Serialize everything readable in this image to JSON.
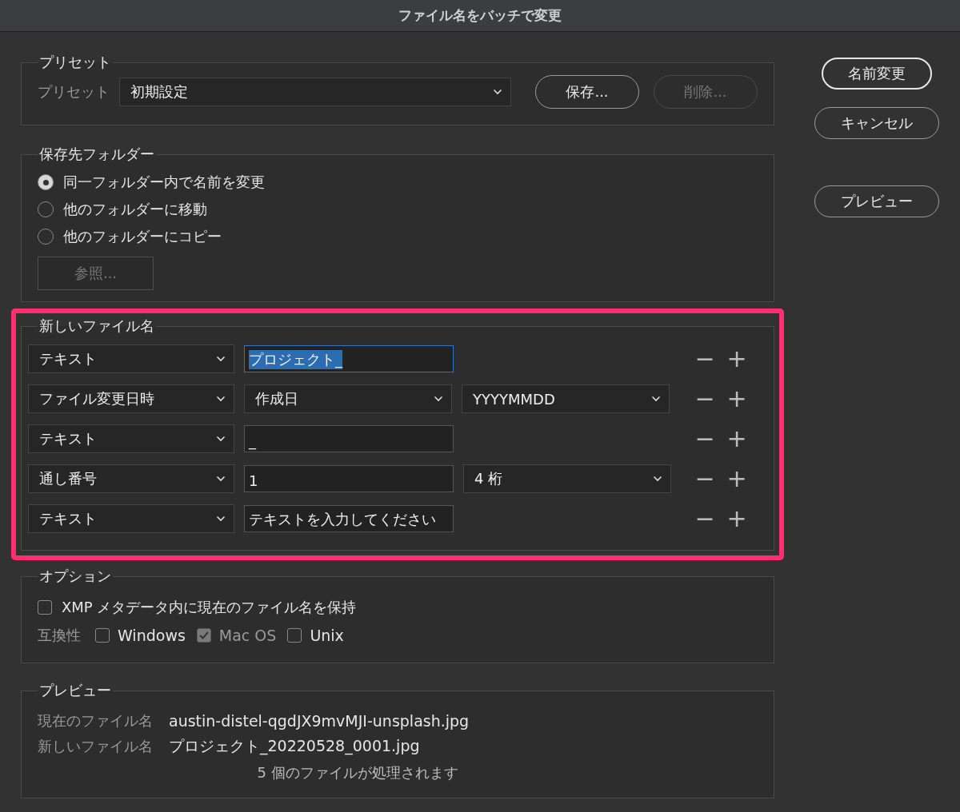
{
  "window": {
    "title": "ファイル名をバッチで変更"
  },
  "actions": [
    {
      "label": "名前変更",
      "primary": true
    },
    {
      "label": "キャンセル",
      "primary": false
    },
    {
      "label": "プレビュー",
      "primary": false
    }
  ],
  "preset": {
    "legend": "プリセット",
    "label": "プリセット",
    "value": "初期設定",
    "buttons": [
      {
        "label": "保存...",
        "disabled": false
      },
      {
        "label": "削除...",
        "disabled": true
      }
    ]
  },
  "destination": {
    "legend": "保存先フォルダー",
    "options": [
      {
        "label": "同一フォルダー内で名前を変更",
        "selected": true
      },
      {
        "label": "他のフォルダーに移動",
        "selected": false
      },
      {
        "label": "他のフォルダーにコピー",
        "selected": false
      }
    ],
    "browse": {
      "label": "参照...",
      "disabled": true
    }
  },
  "new_file_name": {
    "legend": "新しいファイル名",
    "highlighted": true,
    "rows": [
      {
        "parts": [
          {
            "kind": "select",
            "value": "テキスト"
          },
          {
            "kind": "input",
            "value": "プロジェクト_",
            "selected": true
          }
        ],
        "minus": "−",
        "plus": "+"
      },
      {
        "parts": [
          {
            "kind": "select",
            "value": "ファイル変更日時"
          },
          {
            "kind": "select",
            "value": "作成日"
          },
          {
            "kind": "select",
            "value": "YYYYMMDD"
          }
        ],
        "minus": "−",
        "plus": "+"
      },
      {
        "parts": [
          {
            "kind": "select",
            "value": "テキスト"
          },
          {
            "kind": "input",
            "value": "_",
            "selected": false
          }
        ],
        "minus": "−",
        "plus": "+"
      },
      {
        "parts": [
          {
            "kind": "select",
            "value": "通し番号"
          },
          {
            "kind": "input",
            "value": "1",
            "selected": false
          },
          {
            "kind": "select",
            "value": "4 桁"
          }
        ],
        "minus": "−",
        "plus": "+"
      },
      {
        "parts": [
          {
            "kind": "select",
            "value": "テキスト"
          },
          {
            "kind": "input",
            "value": "テキストを入力してください",
            "selected": false
          }
        ],
        "minus": "−",
        "plus": "+"
      }
    ]
  },
  "options": {
    "legend": "オプション",
    "xmp": {
      "label": "XMP メタデータ内に現在のファイル名を保持",
      "checked": false,
      "disabled": false
    },
    "compat_label": "互換性",
    "compat": [
      {
        "label": "Windows",
        "checked": false,
        "disabled": false
      },
      {
        "label": "Mac OS",
        "checked": true,
        "disabled": true
      },
      {
        "label": "Unix",
        "checked": false,
        "disabled": false
      }
    ]
  },
  "preview": {
    "legend": "プレビュー",
    "rows": [
      {
        "label": "現在のファイル名",
        "value": "austin-distel-qgdJX9mvMJI-unsplash.jpg"
      },
      {
        "label": "新しいファイル名",
        "value": "プロジェクト_20220528_0001.jpg"
      }
    ],
    "summary": "5 個のファイルが処理されます"
  }
}
